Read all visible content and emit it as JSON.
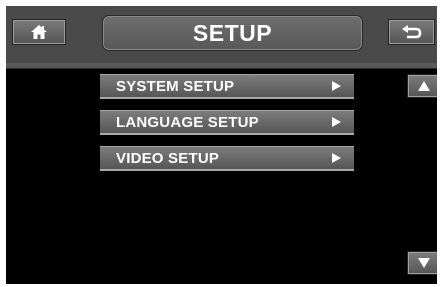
{
  "header": {
    "title": "SETUP",
    "home_icon": "home-icon",
    "back_icon": "return-arrow-icon"
  },
  "menu": {
    "items": [
      {
        "label": "SYSTEM SETUP",
        "icon": "chevron-right-icon"
      },
      {
        "label": "LANGUAGE SETUP",
        "icon": "chevron-right-icon"
      },
      {
        "label": "VIDEO SETUP",
        "icon": "chevron-right-icon"
      }
    ]
  },
  "scroll": {
    "up_icon": "arrow-up-icon",
    "down_icon": "arrow-down-icon"
  },
  "colors": {
    "screen_bg": "#000000",
    "header_bg": "#4a4a4a",
    "button_gray": "#6a6a6a",
    "text": "#ffffff"
  }
}
